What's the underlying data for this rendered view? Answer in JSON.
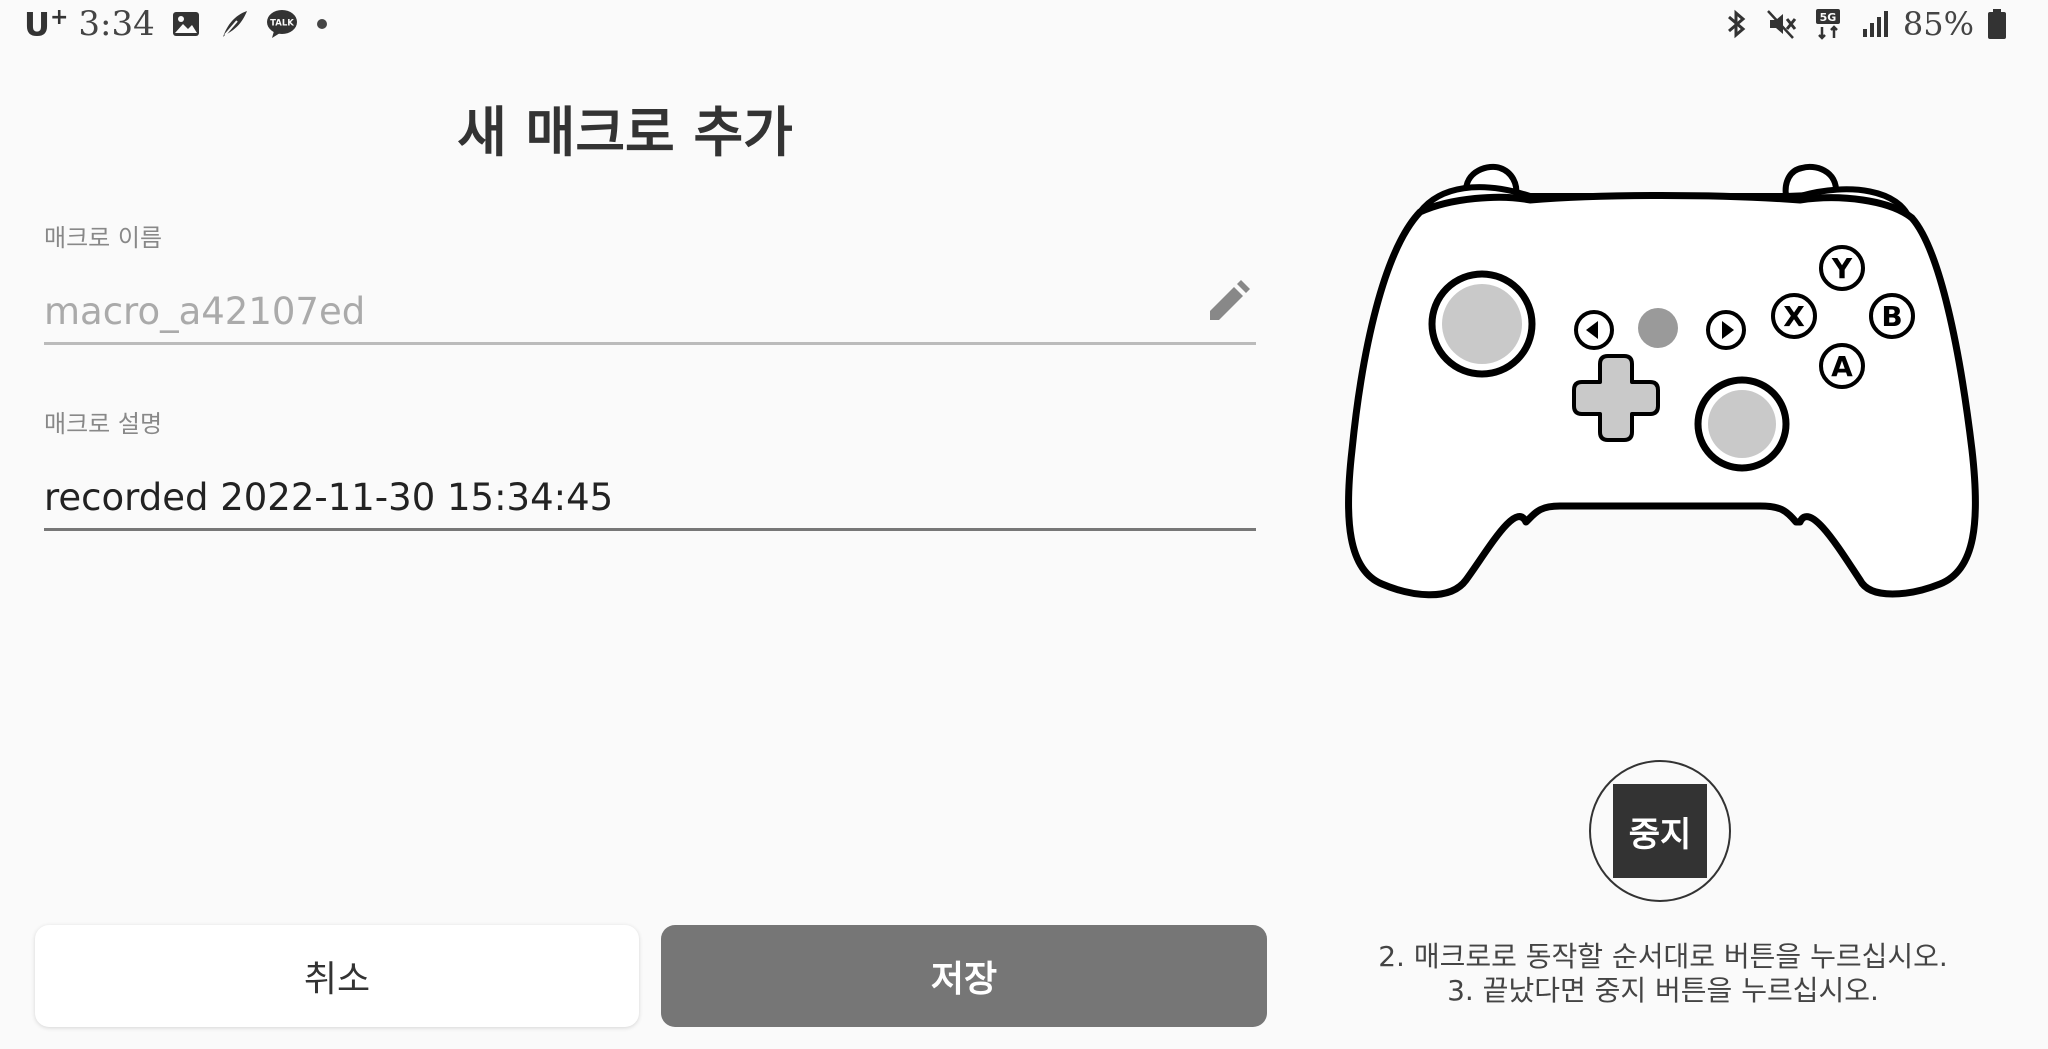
{
  "status_bar": {
    "carrier": "U",
    "carrier_sup": "+",
    "time": "3:34",
    "left_icons": [
      "gallery-icon",
      "feather-app-icon",
      "kakaotalk-icon"
    ],
    "kakao_label": "TALK",
    "right_icons": [
      "bluetooth-icon",
      "mute-icon",
      "5g-icon",
      "signal-icon",
      "battery-icon"
    ],
    "network": "5G",
    "battery": "85%"
  },
  "page": {
    "title": "새 매크로 추가"
  },
  "form": {
    "name_label": "매크로 이름",
    "name_placeholder": "macro_a42107ed",
    "name_value": "",
    "desc_label": "매크로 설명",
    "desc_value": "recorded 2022-11-30 15:34:45"
  },
  "buttons": {
    "cancel": "취소",
    "save": "저장"
  },
  "controller": {
    "face_buttons": {
      "top": "Y",
      "left": "X",
      "right": "B",
      "bottom": "A"
    }
  },
  "recording": {
    "stop_label": "중지",
    "instructions": [
      "2. 매크로로 동작할 순서대로 버튼을 누르십시오.",
      "3. 끝났다면 중지 버튼을 누르십시오."
    ]
  },
  "colors": {
    "background": "#fafafa",
    "save_button": "#767676",
    "stop_button": "#333333"
  }
}
